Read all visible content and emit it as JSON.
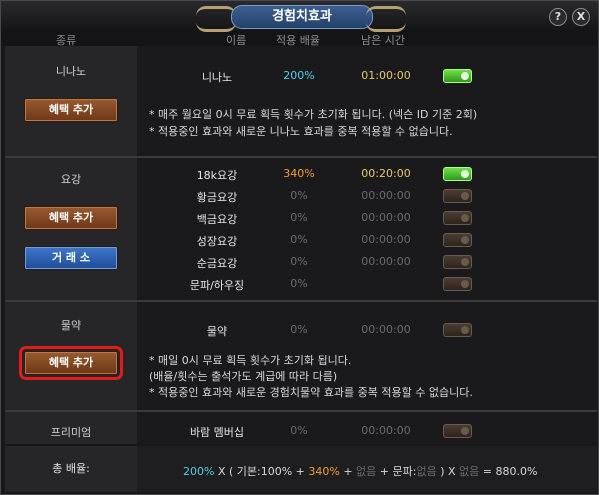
{
  "title": "경험치효과",
  "help_icon": "?",
  "close_icon": "X",
  "headers": {
    "type": "종류",
    "name": "이름",
    "rate": "적용 배율",
    "time": "남은 시간"
  },
  "sections": {
    "nanano": {
      "label": "니나노",
      "button": "혜택 추가",
      "item": {
        "name": "니나노",
        "rate": "200%",
        "time": "01:00:00",
        "toggle": "on"
      },
      "notes": [
        "* 매주 월요일 0시 무료 획득 횟수가 초기화 됩니다. (넥슨 ID 기준 2회)",
        "* 적용중인 효과와 새로운 니나노 효과를 중복 적용할 수 없습니다."
      ]
    },
    "yogang": {
      "label": "요강",
      "button": "혜택 추가",
      "button2": "거 래 소",
      "items": [
        {
          "name": "18k요강",
          "rate": "340%",
          "time": "00:20:00",
          "toggle": "on"
        },
        {
          "name": "황금요강",
          "rate": "0%",
          "time": "00:00:00",
          "toggle": "off"
        },
        {
          "name": "백금요강",
          "rate": "0%",
          "time": "00:00:00",
          "toggle": "off"
        },
        {
          "name": "성장요강",
          "rate": "0%",
          "time": "00:00:00",
          "toggle": "off"
        },
        {
          "name": "순금요강",
          "rate": "0%",
          "time": "00:00:00",
          "toggle": "off"
        },
        {
          "name": "문파/하우징",
          "rate": "0%",
          "time": "",
          "toggle": "off"
        }
      ]
    },
    "potion": {
      "label": "물약",
      "button": "혜택 추가",
      "item": {
        "name": "물약",
        "rate": "0%",
        "time": "00:00:00",
        "toggle": "off"
      },
      "notes": [
        "* 매일 0시 무료 획득 횟수가 초기화 됩니다.",
        "(배율/횟수는 출석가도 계급에 따라 다름)",
        "* 적용중인 효과와 새로운 경험치물약 효과를 중복 적용할 수 없습니다."
      ]
    },
    "premium": {
      "label": "프리미엄",
      "item": {
        "name": "바람 멤버십",
        "rate": "0%",
        "time": "00:00:00",
        "toggle": "off"
      }
    }
  },
  "total": {
    "label": "총 배율:",
    "p1": "200%",
    "p2": " X ( 기본:100% + ",
    "p3": "340%",
    "p4": " + ",
    "p5": "없음",
    "p6": " + 문파:",
    "p7": "없음",
    "p8": " ) X ",
    "p9": "없음",
    "p10": " = 880.0%"
  },
  "colors": {
    "accent_cyan": "#4fd0e8",
    "accent_orange": "#f0a030",
    "time_yellow": "#e8c86a",
    "highlight_red": "#e31b1b"
  }
}
